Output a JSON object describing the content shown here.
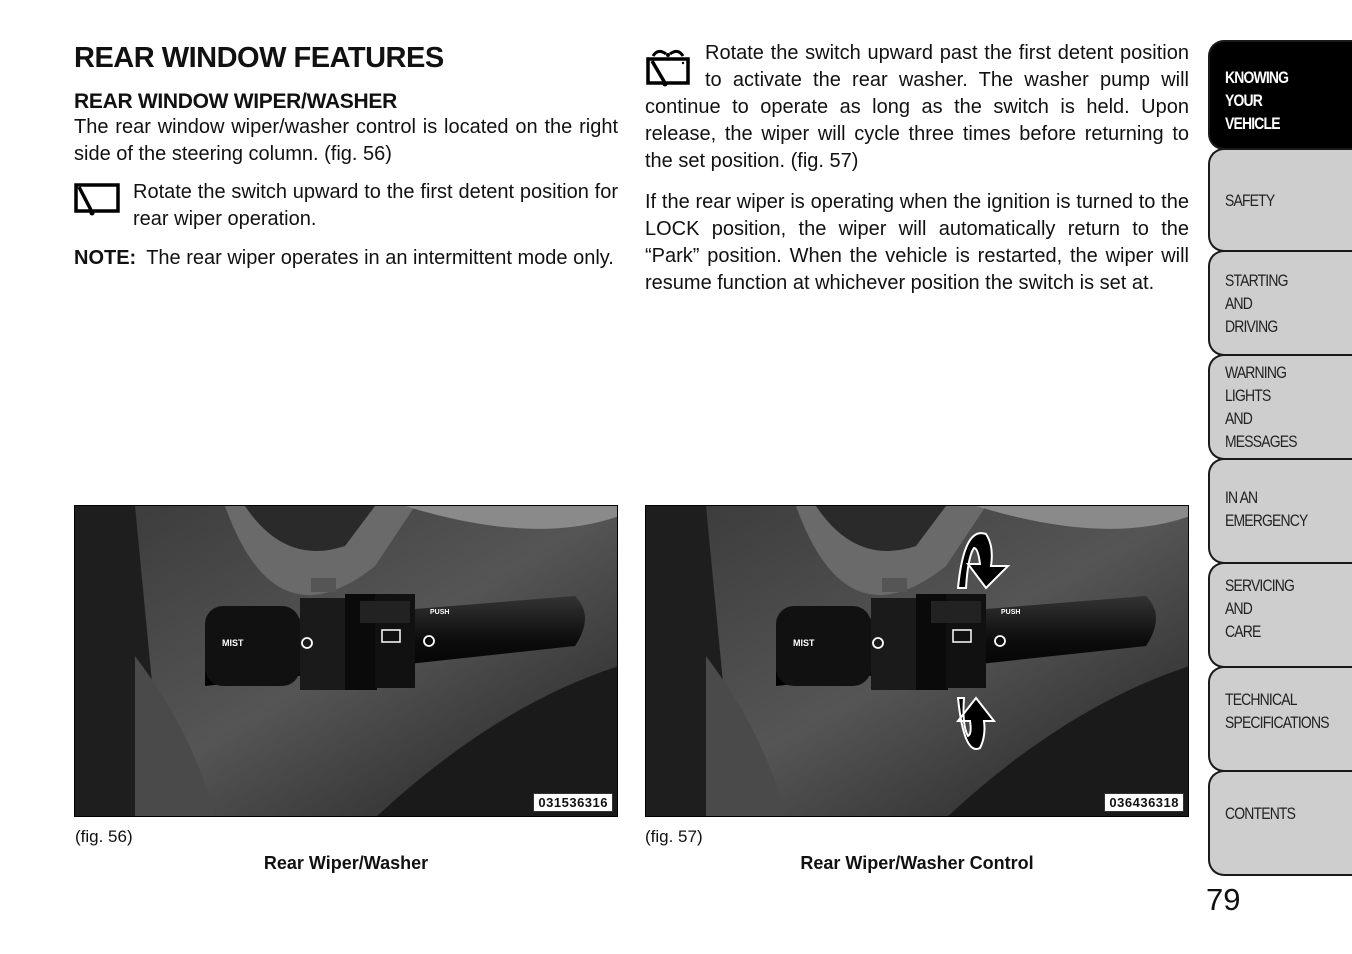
{
  "left_column": {
    "title": "REAR WINDOW FEATURES",
    "subtitle": "REAR WINDOW WIPER/WASHER",
    "intro": "The rear window wiper/washer control is located on the right side of the steering column. (fig.  56)",
    "wiper_icon": "rear-wiper-icon",
    "wiper_text": "Rotate the switch upward to the first detent position for rear wiper operation.",
    "note_label": "NOTE:",
    "note_text": "The rear wiper operates in an intermittent mode only."
  },
  "right_column": {
    "washer_icon": "rear-washer-icon",
    "washer_text": "Rotate the switch upward past the first detent position to activate the rear washer. The washer pump will continue to operate as long as the switch is held. Upon release, the wiper will cycle three times before returning to the set position. (fig.  57)",
    "ignition_text": "If the rear wiper is operating when the ignition is turned to the LOCK position, the wiper will automatically return to the “Park” position. When the vehicle is restarted, the wiper will resume function at whichever position the switch is set at."
  },
  "figures": [
    {
      "ref": "(fig. 56)",
      "caption": "Rear Wiper/Washer",
      "code": "031536316",
      "labels": {
        "mist": "MIST",
        "push": "PUSH"
      }
    },
    {
      "ref": "(fig. 57)",
      "caption": "Rear Wiper/Washer Control",
      "code": "036436318",
      "labels": {
        "mist": "MIST",
        "push": "PUSH"
      }
    }
  ],
  "sidebar": {
    "tabs": [
      {
        "label": "KNOWING\nYOUR\nVEHICLE",
        "active": true
      },
      {
        "label": "SAFETY",
        "active": false
      },
      {
        "label": "STARTING\nAND\nDRIVING",
        "active": false
      },
      {
        "label": "WARNING\nLIGHTS\nAND\nMESSAGES",
        "active": false
      },
      {
        "label": "IN AN\nEMERGENCY",
        "active": false
      },
      {
        "label": "SERVICING\nAND\nCARE",
        "active": false
      },
      {
        "label": "TECHNICAL\nSPECIFICATIONS",
        "active": false
      },
      {
        "label": "CONTENTS",
        "active": false
      }
    ]
  },
  "page_number": "79"
}
